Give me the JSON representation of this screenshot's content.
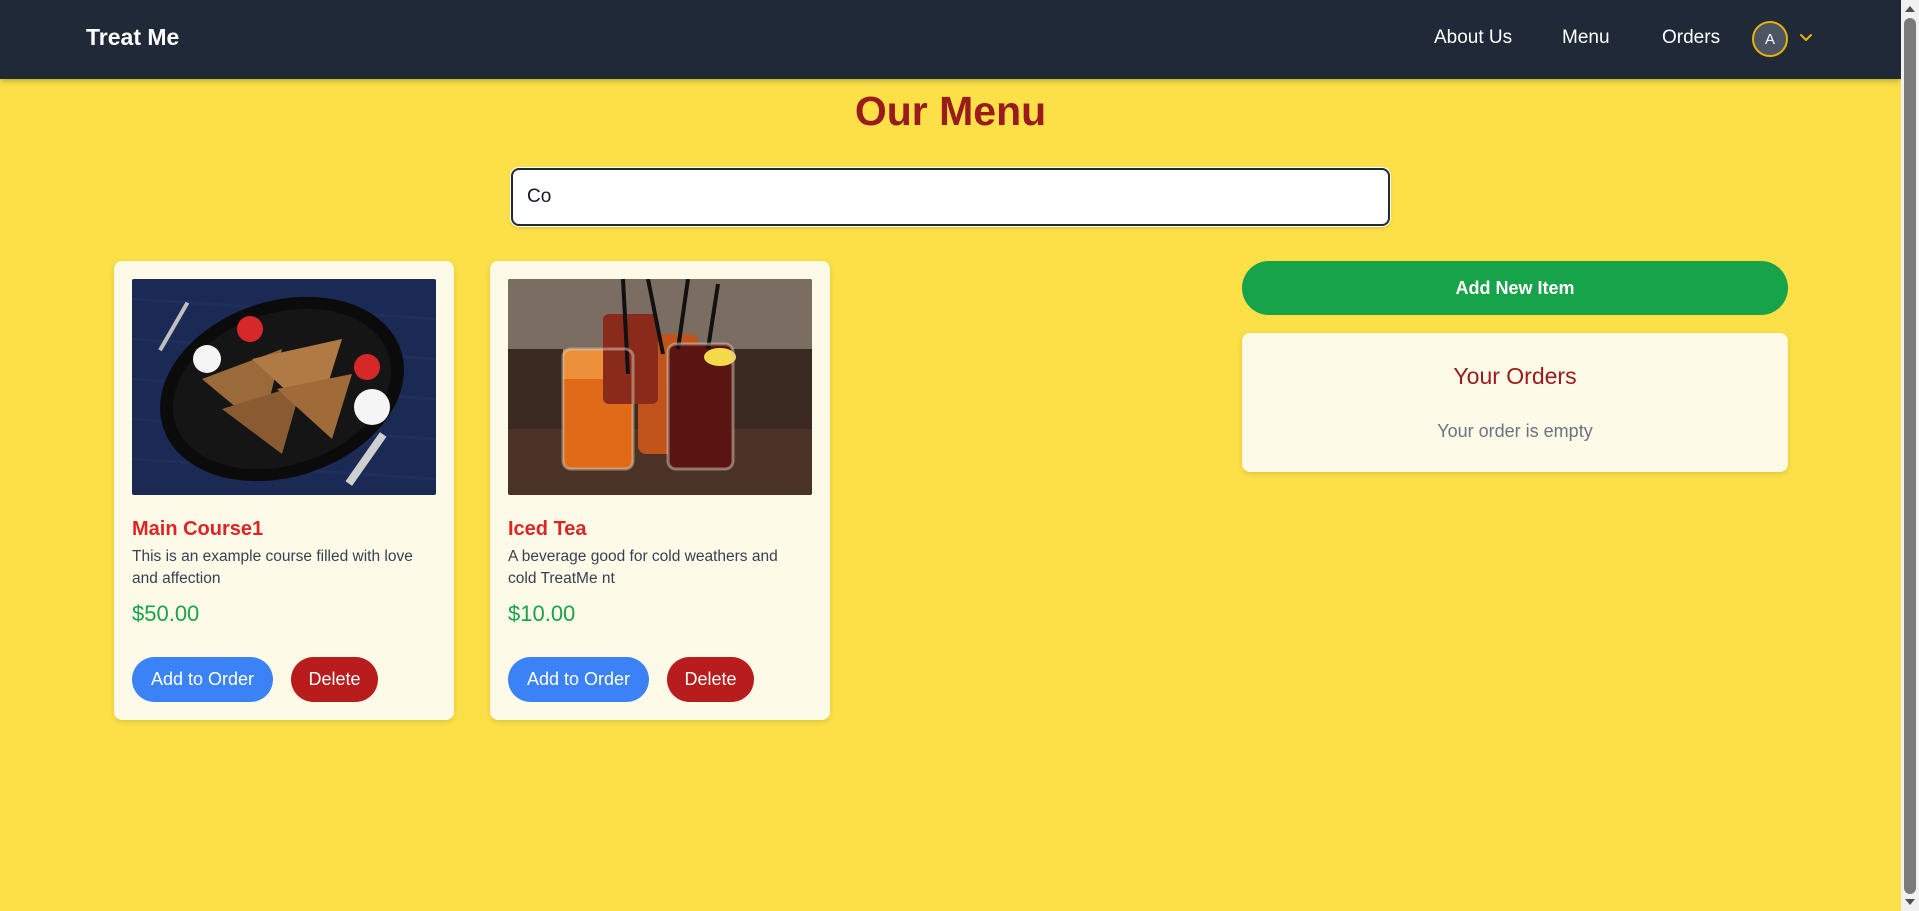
{
  "header": {
    "brand": "Treat Me",
    "nav": [
      "About Us",
      "Menu",
      "Orders"
    ],
    "avatar_initial": "A"
  },
  "main": {
    "title": "Our Menu",
    "search_value": "Co"
  },
  "menu_items": [
    {
      "name": "Main Course1",
      "description": "This is an example course filled with love and affection",
      "price": "$50.00",
      "add_label": "Add to Order",
      "delete_label": "Delete"
    },
    {
      "name": "Iced Tea",
      "description": "A beverage good for cold weathers and cold TreatMe nt",
      "price": "$10.00",
      "add_label": "Add to Order",
      "delete_label": "Delete"
    }
  ],
  "sidebar": {
    "add_new_label": "Add New Item",
    "orders_title": "Your Orders",
    "orders_empty": "Your order is empty"
  },
  "colors": {
    "background": "#fde047",
    "navbar": "#1f2937",
    "title": "#991b1b",
    "add_button": "#3b82f6",
    "delete_button": "#b91c1c",
    "new_item_button": "#16a34a",
    "price": "#16a34a"
  }
}
